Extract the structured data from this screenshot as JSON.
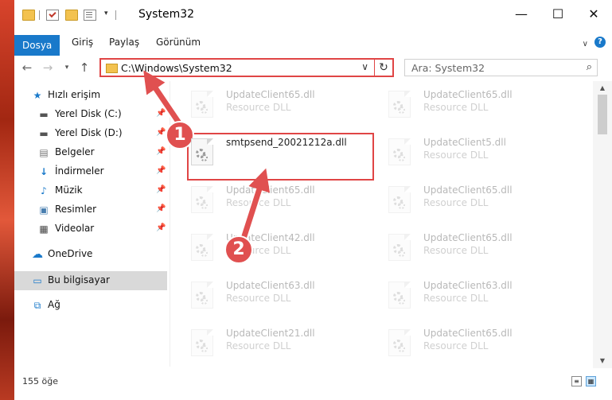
{
  "window": {
    "title": "System32",
    "controls": {
      "minimize": "—",
      "maximize": "☐",
      "close": "✕"
    }
  },
  "ribbon": {
    "tabs": [
      "Dosya",
      "Giriş",
      "Paylaş",
      "Görünüm"
    ],
    "expand": "∨",
    "help": "?"
  },
  "address": {
    "path": "C:\\Windows\\System32",
    "refresh": "↻",
    "chevron": "∨"
  },
  "search": {
    "placeholder": "Ara: System32",
    "icon": "search-icon"
  },
  "nav": {
    "items": [
      {
        "label": "Hızlı erişim",
        "icon": "star-icon",
        "pinned": false
      },
      {
        "label": "Yerel Disk (C:)",
        "icon": "drive-icon",
        "pinned": true
      },
      {
        "label": "Yerel Disk (D:)",
        "icon": "drive-icon",
        "pinned": true
      },
      {
        "label": "Belgeler",
        "icon": "documents-icon",
        "pinned": true
      },
      {
        "label": "İndirmeler",
        "icon": "download-icon",
        "pinned": true
      },
      {
        "label": "Müzik",
        "icon": "music-icon",
        "pinned": true
      },
      {
        "label": "Resimler",
        "icon": "pictures-icon",
        "pinned": true
      },
      {
        "label": "Videolar",
        "icon": "videos-icon",
        "pinned": true
      },
      {
        "label": "OneDrive",
        "icon": "cloud-icon",
        "pinned": false
      },
      {
        "label": "Bu bilgisayar",
        "icon": "computer-icon",
        "pinned": false
      },
      {
        "label": "Ağ",
        "icon": "network-icon",
        "pinned": false
      }
    ]
  },
  "files": {
    "left": [
      {
        "name": "UpdateClient65.dll",
        "type": "Resource DLL"
      },
      {
        "name": "smtpsend_20021212a.dll",
        "type": ""
      },
      {
        "name": "UpdateClient65.dll",
        "type": "Resource DLL"
      },
      {
        "name": "UpdateClient42.dll",
        "type": "Resource DLL"
      },
      {
        "name": "UpdateClient63.dll",
        "type": "Resource DLL"
      },
      {
        "name": "UpdateClient21.dll",
        "type": "Resource DLL"
      }
    ],
    "right": [
      {
        "name": "UpdateClient65.dll",
        "type": "Resource DLL"
      },
      {
        "name": "UpdateClient5.dll",
        "type": "Resource DLL"
      },
      {
        "name": "UpdateClient65.dll",
        "type": "Resource DLL"
      },
      {
        "name": "UpdateClient65.dll",
        "type": "Resource DLL"
      },
      {
        "name": "UpdateClient63.dll",
        "type": "Resource DLL"
      },
      {
        "name": "UpdateClient65.dll",
        "type": "Resource DLL"
      }
    ]
  },
  "status": {
    "count": "155 öğe"
  },
  "callouts": {
    "one": "1",
    "two": "2"
  },
  "colors": {
    "accent": "#1979ca",
    "annotation": "#e04545"
  }
}
